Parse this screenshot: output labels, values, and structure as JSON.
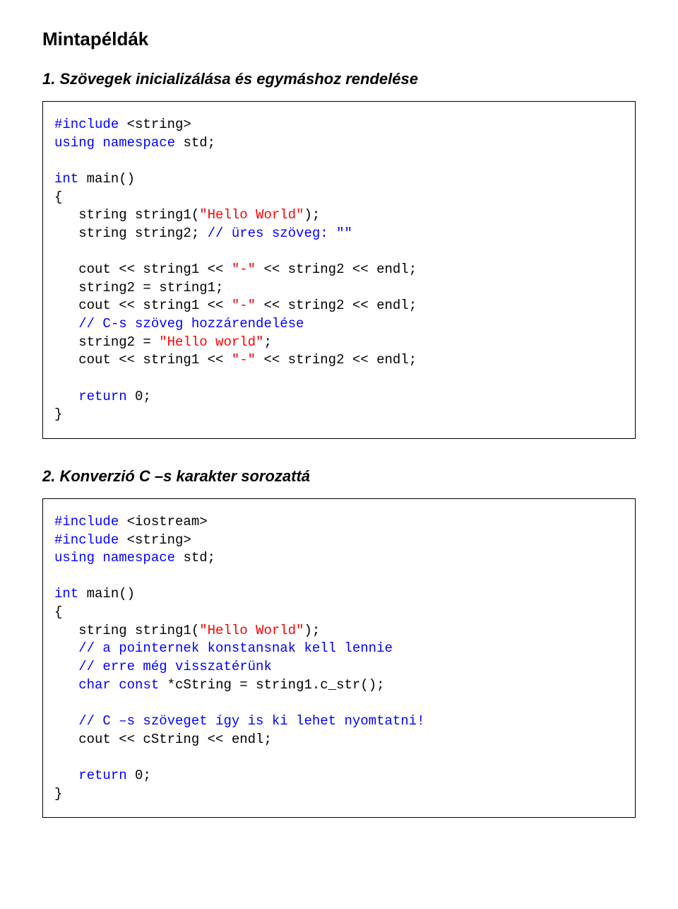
{
  "headings": {
    "main": "Mintapéldák",
    "ex1": "1. Szövegek inicializálása és egymáshoz rendelése",
    "ex2": "2. Konverzió C –s karakter sorozattá"
  },
  "code1": {
    "l01a": "#include",
    "l01b": " <string>",
    "l02a": "using",
    "l02b": " ",
    "l02c": "namespace",
    "l02d": " std;",
    "l03": "",
    "l04a": "int",
    "l04b": " main()",
    "l05": "{",
    "l06a": "   string string1(",
    "l06b": "\"Hello World\"",
    "l06c": ");",
    "l07a": "   string string2; ",
    "l07b": "// üres szöveg: ″″",
    "l08": "",
    "l09a": "   cout << string1 << ",
    "l09b": "″-″",
    "l09c": " << string2 << endl;",
    "l10": "   string2 = string1;",
    "l11a": "   cout << string1 << ",
    "l11b": "″-″",
    "l11c": " << string2 << endl;",
    "l12": "   // C-s szöveg hozzárendelése",
    "l13a": "   string2 = ",
    "l13b": "\"Hello world\"",
    "l13c": ";",
    "l14a": "   cout << string1 << ",
    "l14b": "″-″",
    "l14c": " << string2 << endl;",
    "l15": "",
    "l16a": "   ",
    "l16b": "return",
    "l16c": " 0;",
    "l17": "}"
  },
  "code2": {
    "l01a": "#include",
    "l01b": " <iostream>",
    "l02a": "#include",
    "l02b": " <string>",
    "l03a": "using",
    "l03b": " ",
    "l03c": "namespace",
    "l03d": " std;",
    "l04": "",
    "l05a": "int",
    "l05b": " main()",
    "l06": "{",
    "l07a": "   string string1(",
    "l07b": "\"Hello World\"",
    "l07c": ");",
    "l08": "   // a pointernek konstansnak kell lennie",
    "l09": "   // erre még visszatérünk",
    "l10a": "   ",
    "l10b": "char",
    "l10c": " ",
    "l10d": "const",
    "l10e": " *cString = string1.c_str();",
    "l11": "",
    "l12": "   // C –s szöveget így is ki lehet nyomtatni!",
    "l13": "   cout << cString << endl;",
    "l14": "",
    "l15a": "   ",
    "l15b": "return",
    "l15c": " 0;",
    "l16": "}"
  }
}
